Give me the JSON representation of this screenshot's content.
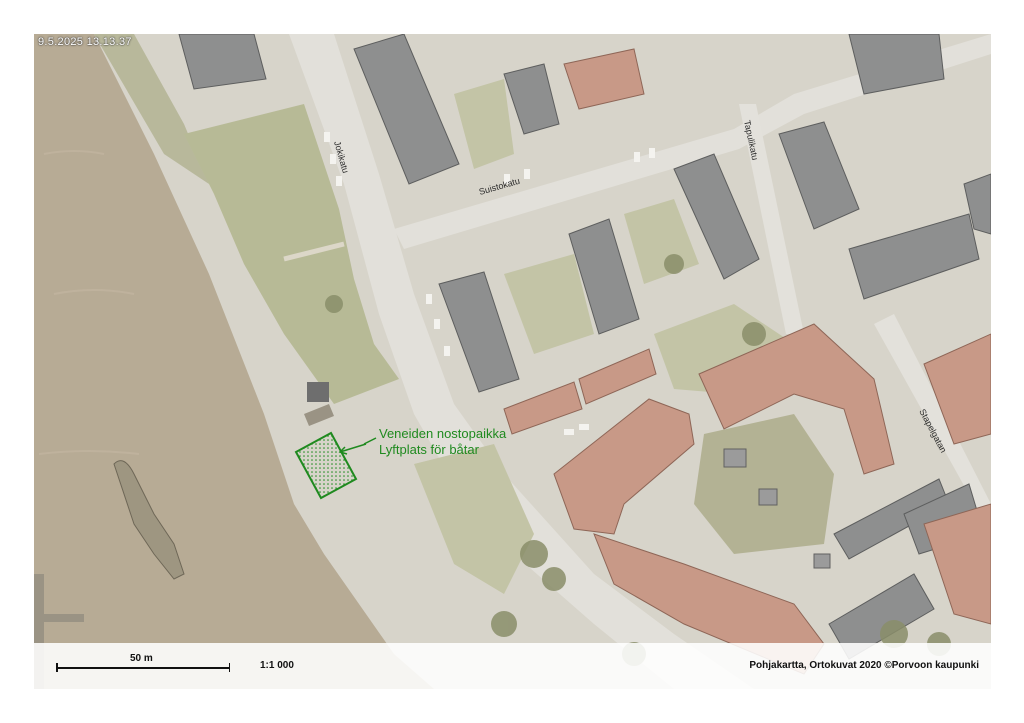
{
  "map": {
    "timestamp": "9.5.2025 13.13.37",
    "streets": {
      "jokikatu": "Jokikatu",
      "suistokatu": "Suistokatu",
      "tapulikatu": "Tapulikatu",
      "stapelgatan": "Stapelgatan"
    },
    "callout": {
      "line1": "Veneiden nostopaikka",
      "line2": "Lyftplats för båtar",
      "color": "#1f8a1f"
    },
    "scale": {
      "distance_label": "50 m",
      "ratio_label": "1:1 000"
    },
    "credits": "Pohjakartta, Ortokuvat 2020 ©Porvoon kaupunki"
  }
}
